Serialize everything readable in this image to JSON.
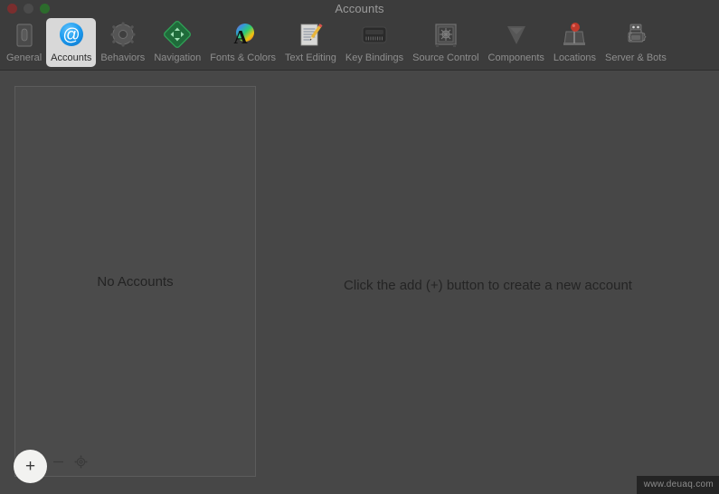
{
  "window": {
    "title": "Accounts",
    "controls": [
      {
        "name": "close",
        "color": "#7a2e2e"
      },
      {
        "name": "minimize",
        "color": "#4b4b4b"
      },
      {
        "name": "maximize",
        "color": "#2c6b2c"
      }
    ]
  },
  "toolbar": {
    "selected": "Accounts",
    "items": [
      {
        "label": "General",
        "icon": "general-icon"
      },
      {
        "label": "Accounts",
        "icon": "at-sign-icon"
      },
      {
        "label": "Behaviors",
        "icon": "gear-icon"
      },
      {
        "label": "Navigation",
        "icon": "navigation-diamond-icon"
      },
      {
        "label": "Fonts & Colors",
        "icon": "fonts-colors-icon"
      },
      {
        "label": "Text Editing",
        "icon": "text-editing-icon"
      },
      {
        "label": "Key Bindings",
        "icon": "keyboard-icon"
      },
      {
        "label": "Source Control",
        "icon": "safe-vault-icon"
      },
      {
        "label": "Components",
        "icon": "components-icon"
      },
      {
        "label": "Locations",
        "icon": "map-pin-icon"
      },
      {
        "label": "Server & Bots",
        "icon": "robot-icon"
      }
    ]
  },
  "sidebar": {
    "empty_message": "No Accounts",
    "controls": {
      "add_label": "+",
      "remove_label": "−",
      "gear_label": "gear-icon"
    }
  },
  "detail": {
    "message": "Click the add (+) button to create a new account"
  },
  "watermark": {
    "text": "www.deuaq.com"
  },
  "colors": {
    "window_background": "#474747",
    "titlebar_background": "#3c3c3c",
    "sidebar_background": "#4b4b4b",
    "selected_tab_background": "#d8d8d8",
    "accent_blue": "#1c9bf0",
    "highlight_circle": "#f2f2f0"
  }
}
